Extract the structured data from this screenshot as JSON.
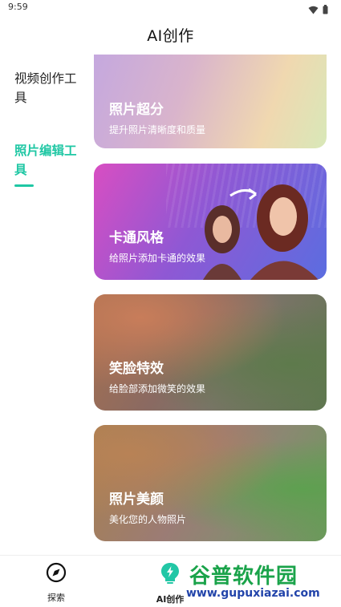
{
  "status_bar": {
    "time": "9:59",
    "icons": [
      "wifi-icon",
      "battery-icon"
    ]
  },
  "header": {
    "title": "AI创作"
  },
  "sidebar": {
    "items": [
      {
        "label": "视频创作工具",
        "selected": false
      },
      {
        "label": "照片编辑工具",
        "selected": true
      }
    ],
    "accent_color": "#1fc7a4"
  },
  "cards": [
    {
      "title": "照片超分",
      "desc": "提升照片清晰度和质量"
    },
    {
      "title": "卡通风格",
      "desc": "给照片添加卡通的效果"
    },
    {
      "title": "笑脸特效",
      "desc": "给脸部添加微笑的效果"
    },
    {
      "title": "照片美颜",
      "desc": "美化您的人物照片"
    }
  ],
  "bottom_nav": {
    "items": [
      {
        "label": "探索",
        "icon": "compass-icon",
        "active": false
      },
      {
        "label": "AI创作",
        "icon": "ai-bulb-icon",
        "active": true
      }
    ]
  },
  "watermark": {
    "line1": "谷普软件园",
    "line2": "www.gupuxiazai.com"
  }
}
